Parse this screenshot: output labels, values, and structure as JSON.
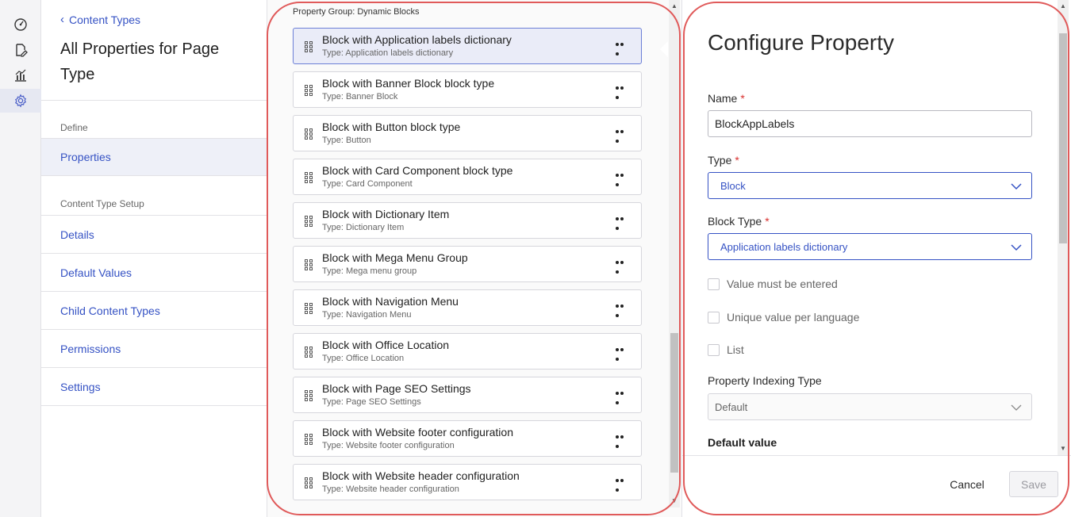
{
  "rail": {
    "icons": [
      "dashboard-gauge-icon",
      "edit-document-icon",
      "analytics-chart-icon",
      "settings-gear-icon"
    ]
  },
  "nav": {
    "back_label": "Content Types",
    "page_title": "All Properties for Page Type",
    "define_label": "Define",
    "properties_label": "Properties",
    "setup_label": "Content Type Setup",
    "items": [
      {
        "label": "Details"
      },
      {
        "label": "Default Values"
      },
      {
        "label": "Child Content Types"
      },
      {
        "label": "Permissions"
      },
      {
        "label": "Settings"
      }
    ]
  },
  "list": {
    "group_label": "Property Group: Dynamic Blocks",
    "properties": [
      {
        "name": "Block with Application labels dictionary",
        "type": "Type: Application labels dictionary"
      },
      {
        "name": "Block with Banner Block block type",
        "type": "Type: Banner Block"
      },
      {
        "name": "Block with Button block type",
        "type": "Type: Button"
      },
      {
        "name": "Block with Card Component block type",
        "type": "Type: Card Component"
      },
      {
        "name": "Block with Dictionary Item",
        "type": "Type: Dictionary Item"
      },
      {
        "name": "Block with Mega Menu Group",
        "type": "Type: Mega menu group"
      },
      {
        "name": "Block with Navigation Menu",
        "type": "Type: Navigation Menu"
      },
      {
        "name": "Block with Office Location",
        "type": "Type: Office Location"
      },
      {
        "name": "Block with Page SEO Settings",
        "type": "Type: Page SEO Settings"
      },
      {
        "name": "Block with Website footer configuration",
        "type": "Type: Website footer configuration"
      },
      {
        "name": "Block with Website header configuration",
        "type": "Type: Website header configuration"
      }
    ]
  },
  "config": {
    "title": "Configure Property",
    "name_label": "Name",
    "name_value": "BlockAppLabels",
    "type_label": "Type",
    "type_value": "Block",
    "block_type_label": "Block Type",
    "block_type_value": "Application labels dictionary",
    "required_mark": "*",
    "value_must_be_entered": "Value must be entered",
    "unique_value_per_language": "Unique value per language",
    "list_label": "List",
    "indexing_label": "Property Indexing Type",
    "indexing_value": "Default",
    "default_value_label": "Default value",
    "cancel_label": "Cancel",
    "save_label": "Save"
  },
  "colors": {
    "accent": "#3552c4",
    "required": "#d9302e",
    "annotation": "#e05a5a",
    "selected_row": "#eaecf8"
  }
}
